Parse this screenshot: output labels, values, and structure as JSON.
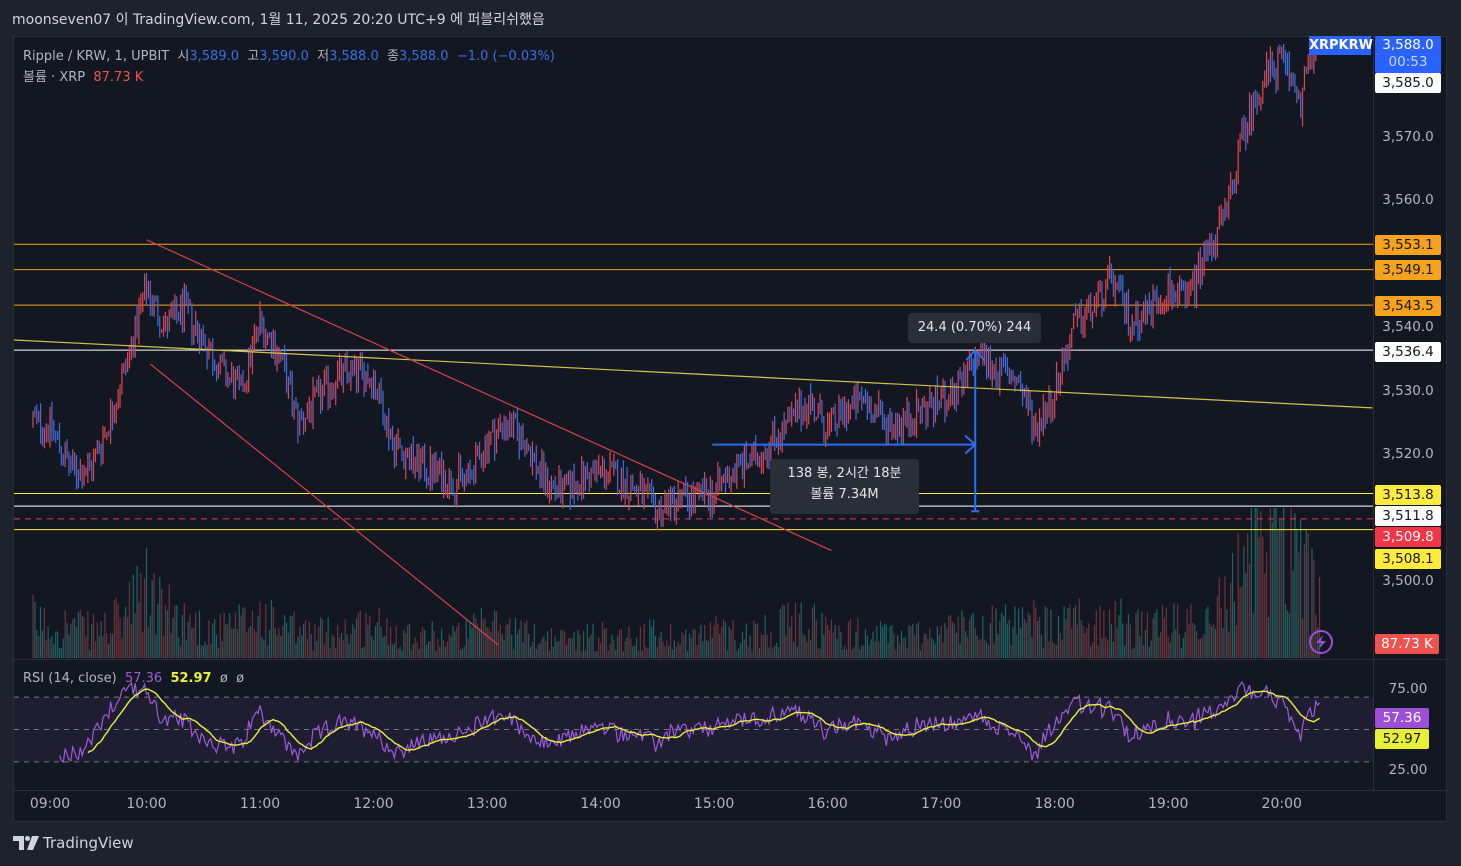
{
  "publish_line": "moonseven07 이 TradingView.com, 1월 11, 2025 20:20 UTC+9 에 퍼블리쉬했음",
  "legend": {
    "symbol": "Ripple / KRW, 1, UPBIT",
    "open_label": "시",
    "open": "3,589.0",
    "high_label": "고",
    "high": "3,590.0",
    "low_label": "저",
    "low": "3,588.0",
    "close_label": "종",
    "close": "3,588.0",
    "change": "−1.0 (−0.03%)",
    "volume_label": "볼륨 · XRP",
    "volume": "87.73 K"
  },
  "rsi_legend": {
    "name": "RSI (14, close)",
    "rsi": "57.36",
    "ma": "52.97",
    "na1": "ø",
    "na2": "ø"
  },
  "price_axis": {
    "ticks": [
      "3,570.0",
      "3,560.0",
      "3,540.0",
      "3,530.0",
      "3,520.0",
      "3,500.0"
    ],
    "symbol_tag": "XRPKRW",
    "last_price": "3,588.0",
    "countdown": "00:53",
    "tags": {
      "p3585": "3,585.0",
      "p3553": "3,553.1",
      "p3549": "3,549.1",
      "p3543": "3,543.5",
      "p3536": "3,536.4",
      "p3513": "3,513.8",
      "p3511": "3,511.8",
      "p3509": "3,509.8",
      "p3508": "3,508.1"
    },
    "volume_tag": "87.73 K",
    "rsi_ticks": [
      "75.00",
      "25.00"
    ],
    "rsi_tag": "57.36",
    "rsi_ma_tag": "52.97"
  },
  "time_axis": [
    "09:00",
    "10:00",
    "11:00",
    "12:00",
    "13:00",
    "14:00",
    "15:00",
    "16:00",
    "17:00",
    "18:00",
    "19:00",
    "20:00"
  ],
  "measure": {
    "price_label": "24.4 (0.70%) 244",
    "bars_label": "138 봉, 2시간 18분",
    "volume_label": "볼륨 7.34M"
  },
  "brand": "TradingView",
  "colors": {
    "up": "#e0464f",
    "down": "#3d6fe0",
    "rsi": "#9c5bd6",
    "rsi_ma": "#e8f03a",
    "accent": "#2962ff"
  },
  "chart_data": {
    "type": "ohlc-bar",
    "title": "Ripple / KRW, 1, UPBIT",
    "interval_minutes": 1,
    "anchor_step_minutes": 10,
    "start_time": "09:00",
    "closes_10min": [
      3525.4,
      3524,
      3517.5,
      3517.5,
      3525,
      3535,
      3546,
      3540,
      3543,
      3538,
      3533,
      3530,
      3541,
      3536,
      3525,
      3528.5,
      3532,
      3533,
      3532,
      3522,
      3519,
      3517.5,
      3516,
      3516,
      3522,
      3525,
      3522,
      3516,
      3514,
      3516,
      3517.5,
      3516,
      3514,
      3511,
      3513,
      3513,
      3514,
      3517.5,
      3519,
      3522,
      3525,
      3528.5,
      3524,
      3527,
      3528.5,
      3525,
      3525,
      3527,
      3528.5,
      3530,
      3536,
      3533,
      3532,
      3524,
      3530,
      3540,
      3543,
      3547.5,
      3541,
      3543,
      3546,
      3544,
      3552,
      3557,
      3571,
      3579,
      3582,
      3576,
      3588
    ],
    "volume_rel_10min": [
      25,
      20,
      22,
      18,
      20,
      30,
      45,
      30,
      25,
      20,
      18,
      22,
      28,
      20,
      18,
      16,
      18,
      20,
      22,
      18,
      16,
      15,
      14,
      16,
      22,
      20,
      16,
      14,
      12,
      14,
      15,
      14,
      14,
      16,
      14,
      14,
      18,
      16,
      16,
      20,
      22,
      24,
      18,
      16,
      16,
      15,
      14,
      16,
      18,
      20,
      28,
      22,
      20,
      24,
      18,
      25,
      22,
      28,
      20,
      18,
      22,
      22,
      30,
      38,
      55,
      80,
      95,
      60,
      40
    ],
    "ylim": [
      3496,
      3586
    ],
    "horizontal_lines": [
      {
        "price": 3553.1,
        "color": "#f7a21b",
        "style": "solid"
      },
      {
        "price": 3549.1,
        "color": "#f7a21b",
        "style": "solid"
      },
      {
        "price": 3543.5,
        "color": "#f7a21b",
        "style": "solid"
      },
      {
        "price": 3536.4,
        "color": "#ffffff",
        "style": "solid"
      },
      {
        "price": 3513.8,
        "color": "#ffeb3b",
        "style": "solid"
      },
      {
        "price": 3511.8,
        "color": "#ffffff",
        "style": "solid"
      },
      {
        "price": 3509.8,
        "color": "#f23645",
        "style": "dashed"
      },
      {
        "price": 3508.1,
        "color": "#ffeb3b",
        "style": "solid"
      },
      {
        "price": 3585.0,
        "color": "#ffffff",
        "style": "solid"
      }
    ],
    "trend_lines": [
      {
        "t1": -10,
        "p1": 3538.0,
        "t2": 708,
        "p2": 3527.3,
        "color": "#d4c24a"
      },
      {
        "t1": 60,
        "p1": 3553.8,
        "t2": 422,
        "p2": 3504.8,
        "color": "#d9414a"
      },
      {
        "t1": 62,
        "p1": 3534.2,
        "t2": 246,
        "p2": 3489.9,
        "color": "#d9414a"
      }
    ],
    "measure_tool": {
      "t_start": 359,
      "t_end": 498,
      "p_from": 3511.0,
      "p_to": 3536.4,
      "p_mid": 3521.5
    },
    "rsi": {
      "period": 14,
      "levels": [
        70,
        50,
        30
      ],
      "last": 57.36,
      "ma_last": 52.97
    }
  }
}
